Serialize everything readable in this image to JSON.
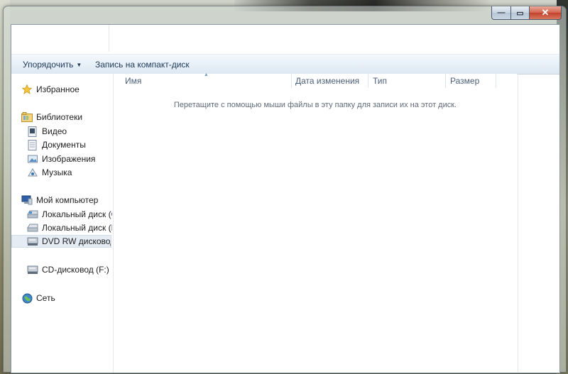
{
  "window": {
    "controls": {
      "minimize": "—",
      "maximize": "▭",
      "close": "✕"
    }
  },
  "toolbar": {
    "organize_label": "Упорядочить",
    "burn_label": "Запись на компакт-диск"
  },
  "sidebar": {
    "favorites": "Избранное",
    "libraries": "Библиотеки",
    "library_items": [
      "Видео",
      "Документы",
      "Изображения",
      "Музыка"
    ],
    "computer": "Мой компьютер",
    "drives": [
      "Локальный диск (C:)",
      "Локальный диск (D:)",
      "DVD RW дисковод (",
      "CD-дисковод (F:)"
    ],
    "network": "Сеть"
  },
  "columns": [
    "Имя",
    "Дата изменения",
    "Тип",
    "Размер"
  ],
  "empty_message": "Перетащите с помощью мыши файлы в эту папку для записи их на этот диск.",
  "colors": {
    "accent": "#1e3a57",
    "selection": "#e5ecf4",
    "close": "#c1422a"
  }
}
